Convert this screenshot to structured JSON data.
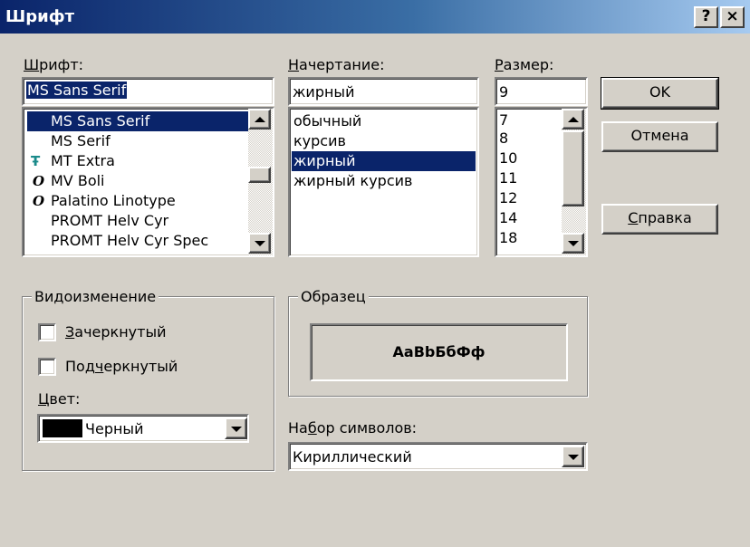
{
  "window": {
    "title": "Шрифт",
    "help_glyph": "?",
    "close_glyph": "×"
  },
  "font": {
    "label": "Шрифт:",
    "underline_char": "Ш",
    "label_rest": "рифт:",
    "value": "MS Sans Serif",
    "items": [
      {
        "label": "MS Sans Serif",
        "icon": "",
        "selected": true
      },
      {
        "label": "MS Serif",
        "icon": ""
      },
      {
        "label": "MT Extra",
        "icon": "truetype-icon"
      },
      {
        "label": "MV Boli",
        "icon": "opentype-icon"
      },
      {
        "label": "Palatino Linotype",
        "icon": "opentype-icon"
      },
      {
        "label": "PROMT Helv Cyr",
        "icon": ""
      },
      {
        "label": "PROMT Helv Cyr Spec",
        "icon": ""
      }
    ]
  },
  "style": {
    "label_u": "Н",
    "label_rest": "ачертание:",
    "value": "жирный",
    "items": [
      {
        "label": "обычный"
      },
      {
        "label": "курсив"
      },
      {
        "label": "жирный",
        "selected": true
      },
      {
        "label": "жирный курсив"
      }
    ]
  },
  "size": {
    "label_u": "Р",
    "label_rest": "азмер:",
    "value": "9",
    "items": [
      "7",
      "8",
      "10",
      "11",
      "12",
      "14",
      "18"
    ]
  },
  "buttons": {
    "ok": "OK",
    "cancel": "Отмена",
    "help_u": "С",
    "help_rest": "правка"
  },
  "effects": {
    "title": "Видоизменение",
    "strike_u": "З",
    "strike_rest": "ачеркнутый",
    "underline_pre": "Под",
    "underline_u": "ч",
    "underline_rest": "еркнутый",
    "color_pre": "Ц",
    "color_rest": "вет:",
    "color_value": "Черный",
    "color_swatch": "#000000"
  },
  "sample": {
    "title": "Образец",
    "text": "AaBbБбФф"
  },
  "charset": {
    "label_pre": "На",
    "label_u": "б",
    "label_rest": "ор символов:",
    "value": "Кириллический"
  },
  "icons": {
    "truetype": "Ŧ",
    "opentype": "O"
  }
}
